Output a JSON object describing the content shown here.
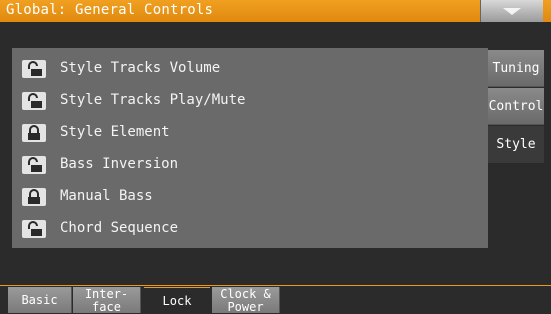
{
  "header": {
    "title": "Global: General Controls",
    "menu_icon": "chevron-down-icon"
  },
  "rows": [
    {
      "label": "Style Tracks Volume",
      "locked": false
    },
    {
      "label": "Style Tracks Play/Mute",
      "locked": false
    },
    {
      "label": "Style Element",
      "locked": true
    },
    {
      "label": "Bass Inversion",
      "locked": false
    },
    {
      "label": "Manual Bass",
      "locked": true
    },
    {
      "label": "Chord Sequence",
      "locked": false
    }
  ],
  "side_tabs": [
    {
      "label": "Tuning",
      "active": false
    },
    {
      "label": "Control",
      "active": false
    },
    {
      "label": "Style",
      "active": true
    }
  ],
  "bottom_tabs": [
    {
      "label": "Basic",
      "active": false
    },
    {
      "label": "Inter-\nface",
      "line1": "Inter-",
      "line2": "face",
      "active": false
    },
    {
      "label": "Lock",
      "active": true
    },
    {
      "label": "Clock &\nPower",
      "line1": "Clock &",
      "line2": "Power",
      "active": false
    }
  ],
  "colors": {
    "accent": "#e89a20",
    "panel": "#6a6a6a",
    "background": "#2b2b2b"
  }
}
